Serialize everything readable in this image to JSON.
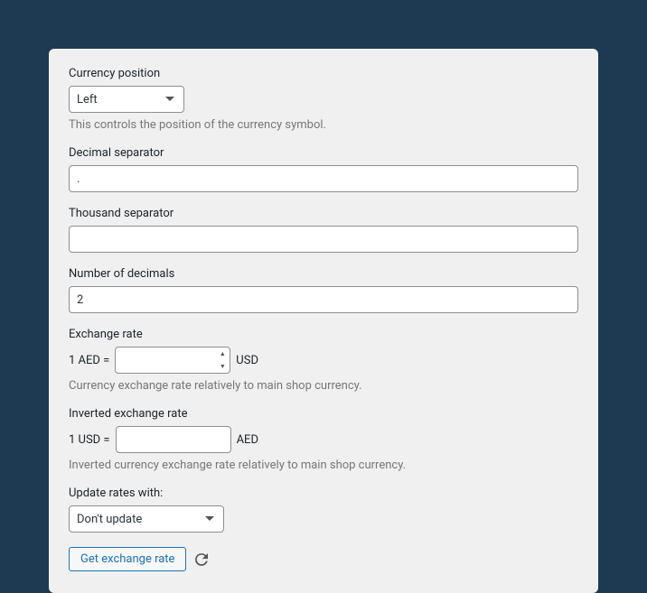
{
  "fields": {
    "currency_position": {
      "label": "Currency position",
      "value": "Left",
      "description": "This controls the position of the currency symbol."
    },
    "decimal_separator": {
      "label": "Decimal separator",
      "value": "."
    },
    "thousand_separator": {
      "label": "Thousand separator",
      "value": ""
    },
    "number_of_decimals": {
      "label": "Number of decimals",
      "value": "2"
    },
    "exchange_rate": {
      "label": "Exchange rate",
      "prefix": "1 AED =",
      "value": "",
      "suffix": "USD",
      "description": "Currency exchange rate relatively to main shop currency."
    },
    "inverted_exchange_rate": {
      "label": "Inverted exchange rate",
      "prefix": "1 USD =",
      "value": "",
      "suffix": "AED",
      "description": "Inverted currency exchange rate relatively to main shop currency."
    },
    "update_rates": {
      "label": "Update rates with:",
      "value": "Don't update"
    },
    "get_exchange_rate": {
      "button": "Get exchange rate"
    }
  }
}
